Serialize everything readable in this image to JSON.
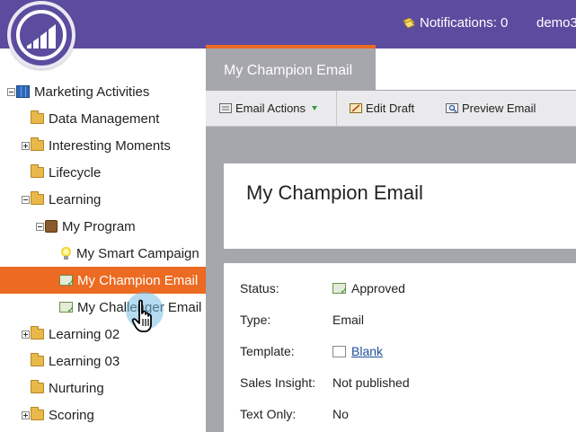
{
  "header": {
    "notifications_label": "Notifications: 0",
    "user_label": "demo3"
  },
  "tree": {
    "items": [
      {
        "label": "Marketing Activities",
        "icon": "books-icon",
        "expander": "minus",
        "indent": 0
      },
      {
        "label": "Data Management",
        "icon": "folder-icon",
        "expander": "none",
        "indent": 1
      },
      {
        "label": "Interesting Moments",
        "icon": "folder-icon",
        "expander": "plus",
        "indent": 1
      },
      {
        "label": "Lifecycle",
        "icon": "folder-icon",
        "expander": "none",
        "indent": 1
      },
      {
        "label": "Learning",
        "icon": "folder-icon",
        "expander": "minus",
        "indent": 1
      },
      {
        "label": "My Program",
        "icon": "program-icon",
        "expander": "minus",
        "indent": 2
      },
      {
        "label": "My Smart Campaign",
        "icon": "lightbulb-icon",
        "expander": "none",
        "indent": 3
      },
      {
        "label": "My Champion Email",
        "icon": "email-icon",
        "expander": "none",
        "indent": 3,
        "selected": true
      },
      {
        "label": "My Challenger Email",
        "icon": "email-icon",
        "expander": "none",
        "indent": 3
      },
      {
        "label": "Learning 02",
        "icon": "folder-icon",
        "expander": "plus",
        "indent": 1
      },
      {
        "label": "Learning 03",
        "icon": "folder-icon",
        "expander": "none",
        "indent": 1
      },
      {
        "label": "Nurturing",
        "icon": "folder-icon",
        "expander": "none",
        "indent": 1
      },
      {
        "label": "Scoring",
        "icon": "folder-icon",
        "expander": "plus",
        "indent": 1
      }
    ]
  },
  "tab": {
    "label": "My Champion Email"
  },
  "toolbar": {
    "email_actions": "Email Actions",
    "edit_draft": "Edit Draft",
    "preview_email": "Preview Email"
  },
  "main": {
    "title": "My Champion Email",
    "details": {
      "status_label": "Status:",
      "status_value": "Approved",
      "type_label": "Type:",
      "type_value": "Email",
      "template_label": "Template:",
      "template_value": "Blank",
      "sales_insight_label": "Sales Insight:",
      "sales_insight_value": "Not published",
      "text_only_label": "Text Only:",
      "text_only_value": "No"
    }
  },
  "colors": {
    "header": "#5c4c9f",
    "accent": "#ec6a22",
    "panel_bg": "#a6a6ad",
    "link": "#1f4f9a"
  }
}
